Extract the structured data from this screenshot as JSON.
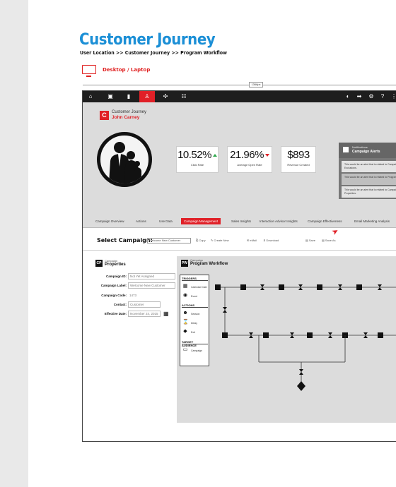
{
  "page": {
    "title": "Customer Journey",
    "breadcrumb": "User Location >> Customer Journey >> Program Workflow",
    "device_label": "Desktop / Laptop",
    "width_tag": "1366px"
  },
  "app": {
    "header": {
      "journey_label": "Customer Journey",
      "customer_name": "John Carney",
      "logo_letter": "C"
    },
    "metrics": [
      {
        "value": "10.52%",
        "label": "Click Rate",
        "trend": "up"
      },
      {
        "value": "21.96%",
        "label": "Average Open Rate",
        "trend": "down"
      },
      {
        "value": "$893",
        "label": "Revenue Created",
        "trend": "none"
      }
    ],
    "notifications": {
      "subtitle": "Notifications",
      "title": "Campaign Alerts",
      "alerts": [
        "This would be an alert that is related to Campaign Exclusions.",
        "This would be an alert that is related to Program",
        "This would be an alert that is related to Campaign Properties."
      ]
    },
    "tabs": [
      "Campaign Overview",
      "Actions",
      "Use Data",
      "Campaign Management",
      "Sales Insights",
      "Interaction Advisor Insights",
      "Campaign Effectiveness",
      "Email Marketing Analysis"
    ],
    "active_tab": "Campaign Management",
    "select_campaign": {
      "label": "Select Campaign:",
      "value": "Welcome New Customer",
      "tools": [
        "Copy",
        "Create New",
        "eMail",
        "Download",
        "Save",
        "Save As"
      ]
    },
    "properties": {
      "subtitle": "Campaign",
      "title": "Properties",
      "icon_text": "CP",
      "fields": [
        {
          "label": "Campaign ID:",
          "value": "Not Yet Assigned",
          "boxed": true
        },
        {
          "label": "Campaign Label:",
          "value": "Welcome New Customer",
          "boxed": true
        },
        {
          "label": "Campaign Code:",
          "value": "1473",
          "boxed": false
        },
        {
          "label": "Contact:",
          "value": "Customer",
          "boxed": true
        },
        {
          "label": "Effective Date:",
          "value": "November 24, 2015",
          "boxed": true
        }
      ]
    },
    "workflow": {
      "subtitle": "Campaign",
      "title": "Program Workflow",
      "icon_text": "PW",
      "palette": {
        "triggers_head": "TRIGGERS",
        "triggers": [
          "Calendar Date",
          "Event"
        ],
        "actions_head": "ACTIONS",
        "actions": [
          "Session",
          "Delay",
          "Exit"
        ],
        "audience_head": "TARGET AUDIENCE",
        "audience": [
          "Campaign"
        ]
      }
    }
  }
}
